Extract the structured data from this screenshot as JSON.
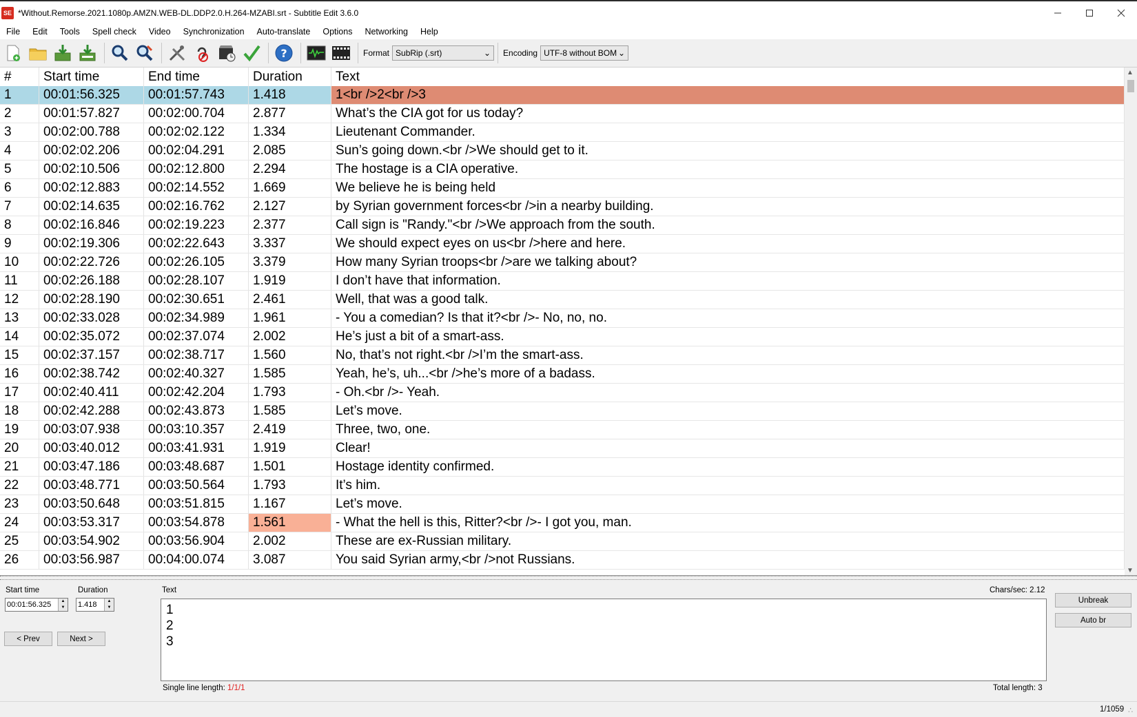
{
  "window": {
    "title": "*Without.Remorse.2021.1080p.AMZN.WEB-DL.DDP2.0.H.264-MZABI.srt - Subtitle Edit 3.6.0",
    "app_icon_text": "SE"
  },
  "menu": [
    "File",
    "Edit",
    "Tools",
    "Spell check",
    "Video",
    "Synchronization",
    "Auto-translate",
    "Options",
    "Networking",
    "Help"
  ],
  "toolbar": {
    "format_label": "Format",
    "format_value": "SubRip (.srt)",
    "encoding_label": "Encoding",
    "encoding_value": "UTF-8 without BOM",
    "icons": [
      "new-file-icon",
      "open-folder-icon",
      "save-icon",
      "save-as-icon",
      "find-icon",
      "replace-icon",
      "fix-common-errors-icon",
      "remove-hearing-impaired-icon",
      "visual-sync-icon",
      "spell-check-icon",
      "help-icon",
      "waveform-icon",
      "video-icon"
    ]
  },
  "grid": {
    "headers": [
      "#",
      "Start time",
      "End time",
      "Duration",
      "Text"
    ],
    "rows": [
      [
        "1",
        "00:01:56.325",
        "00:01:57.743",
        "1.418",
        "1<br />2<br />3"
      ],
      [
        "2",
        "00:01:57.827",
        "00:02:00.704",
        "2.877",
        "What’s the CIA got for us today?"
      ],
      [
        "3",
        "00:02:00.788",
        "00:02:02.122",
        "1.334",
        "Lieutenant Commander."
      ],
      [
        "4",
        "00:02:02.206",
        "00:02:04.291",
        "2.085",
        "Sun’s going down.<br />We should get to it."
      ],
      [
        "5",
        "00:02:10.506",
        "00:02:12.800",
        "2.294",
        "The hostage is a CIA operative."
      ],
      [
        "6",
        "00:02:12.883",
        "00:02:14.552",
        "1.669",
        "We believe he is being held"
      ],
      [
        "7",
        "00:02:14.635",
        "00:02:16.762",
        "2.127",
        "by Syrian government forces<br />in a nearby building."
      ],
      [
        "8",
        "00:02:16.846",
        "00:02:19.223",
        "2.377",
        "Call sign is \"Randy.\"<br />We approach from the south."
      ],
      [
        "9",
        "00:02:19.306",
        "00:02:22.643",
        "3.337",
        "We should expect eyes on us<br />here and here."
      ],
      [
        "10",
        "00:02:22.726",
        "00:02:26.105",
        "3.379",
        "How many Syrian troops<br />are we talking about?"
      ],
      [
        "11",
        "00:02:26.188",
        "00:02:28.107",
        "1.919",
        "I don’t have that information."
      ],
      [
        "12",
        "00:02:28.190",
        "00:02:30.651",
        "2.461",
        "Well, that was a good talk."
      ],
      [
        "13",
        "00:02:33.028",
        "00:02:34.989",
        "1.961",
        "- You a comedian? Is that it?<br />- No, no, no."
      ],
      [
        "14",
        "00:02:35.072",
        "00:02:37.074",
        "2.002",
        "He’s just a bit of a smart-ass."
      ],
      [
        "15",
        "00:02:37.157",
        "00:02:38.717",
        "1.560",
        "No, that’s not right.<br />I’m the smart-ass."
      ],
      [
        "16",
        "00:02:38.742",
        "00:02:40.327",
        "1.585",
        "Yeah, he’s, uh...<br />he’s more of a badass."
      ],
      [
        "17",
        "00:02:40.411",
        "00:02:42.204",
        "1.793",
        "- Oh.<br />- Yeah."
      ],
      [
        "18",
        "00:02:42.288",
        "00:02:43.873",
        "1.585",
        "Let’s move."
      ],
      [
        "19",
        "00:03:07.938",
        "00:03:10.357",
        "2.419",
        "Three, two, one."
      ],
      [
        "20",
        "00:03:40.012",
        "00:03:41.931",
        "1.919",
        "Clear!"
      ],
      [
        "21",
        "00:03:47.186",
        "00:03:48.687",
        "1.501",
        "Hostage identity confirmed."
      ],
      [
        "22",
        "00:03:48.771",
        "00:03:50.564",
        "1.793",
        "It’s him."
      ],
      [
        "23",
        "00:03:50.648",
        "00:03:51.815",
        "1.167",
        "Let’s move."
      ],
      [
        "24",
        "00:03:53.317",
        "00:03:54.878",
        "1.561",
        "- What the hell is this, Ritter?<br />- I got you, man."
      ],
      [
        "25",
        "00:03:54.902",
        "00:03:56.904",
        "2.002",
        "These are ex-Russian military."
      ],
      [
        "26",
        "00:03:56.987",
        "00:04:00.074",
        "3.087",
        "You said Syrian army,<br />not Russians."
      ]
    ]
  },
  "editor": {
    "start_time_label": "Start time",
    "start_time_value": "00:01:56.325",
    "duration_label": "Duration",
    "duration_value": "1.418",
    "prev_label": "< Prev",
    "next_label": "Next >",
    "text_label": "Text",
    "chars_sec": "Chars/sec: 2.12",
    "text_lines": [
      "1",
      "2",
      "3"
    ],
    "single_line_label": "Single line length:",
    "single_line_value": "1/1/1",
    "total_length": "Total length: 3",
    "unbreak_label": "Unbreak",
    "auto_br_label": "Auto br"
  },
  "status": {
    "position": "1/1059"
  },
  "colors": {
    "selected_row": "#add8e6",
    "selected_text": "#de8b73",
    "warning_cell": "#f9b096",
    "error_text": "#e02020"
  }
}
